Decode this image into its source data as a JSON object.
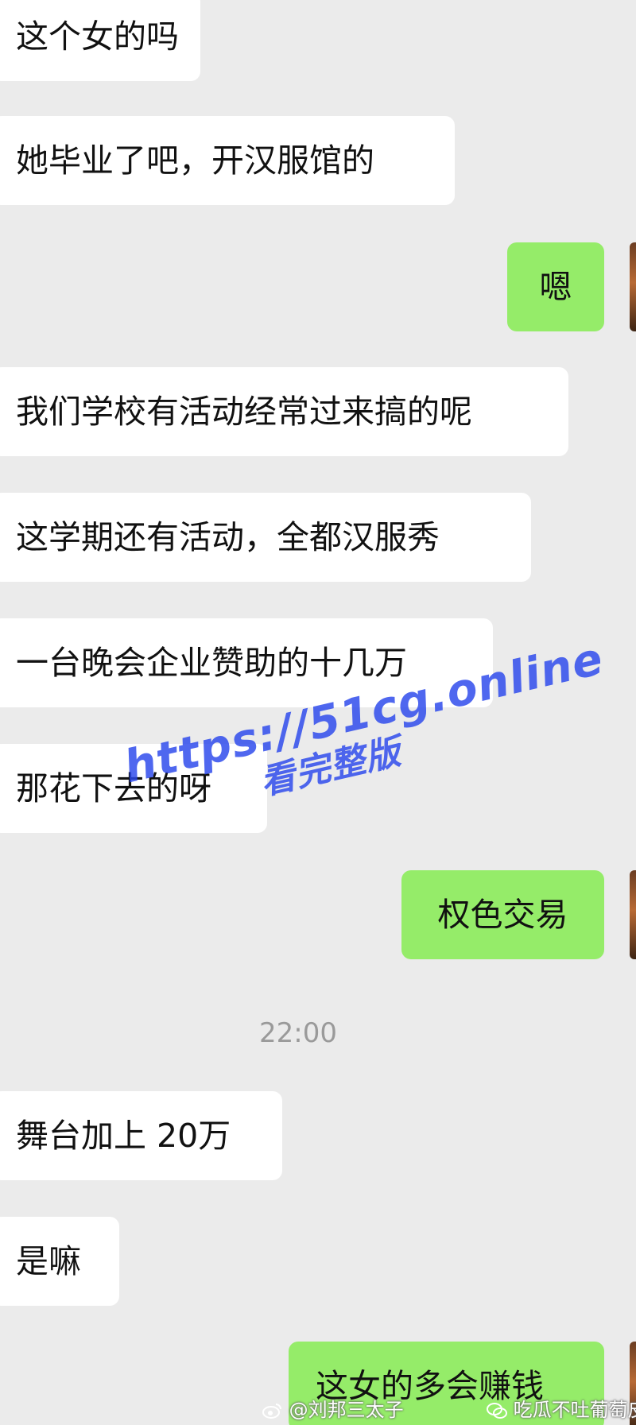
{
  "messages": [
    {
      "side": "left",
      "text": "这个女的吗"
    },
    {
      "side": "left",
      "text": "她毕业了吧，开汉服馆的"
    },
    {
      "side": "right",
      "text": "嗯"
    },
    {
      "side": "left",
      "text": "我们学校有活动经常过来搞的呢"
    },
    {
      "side": "left",
      "text": "这学期还有活动，全都汉服秀"
    },
    {
      "side": "left",
      "text": "一台晚会企业赞助的十几万"
    },
    {
      "side": "left",
      "text": "那花下去的呀"
    },
    {
      "side": "right",
      "text": "权色交易"
    },
    {
      "side": "left",
      "text": "舞台加上 20万"
    },
    {
      "side": "left",
      "text": "是嘛"
    },
    {
      "side": "right",
      "text": "这女的多会赚钱"
    }
  ],
  "timestamp": "22:00",
  "watermark": {
    "url": "https://51cg.online",
    "subtitle": "看完整版"
  },
  "credits": {
    "weibo": "@刘邦三太子",
    "account": "吃瓜不吐葡萄皮"
  },
  "colors": {
    "background": "#ebebeb",
    "incoming_bubble": "#ffffff",
    "outgoing_bubble": "#95ec69",
    "watermark": "#2846eb"
  }
}
